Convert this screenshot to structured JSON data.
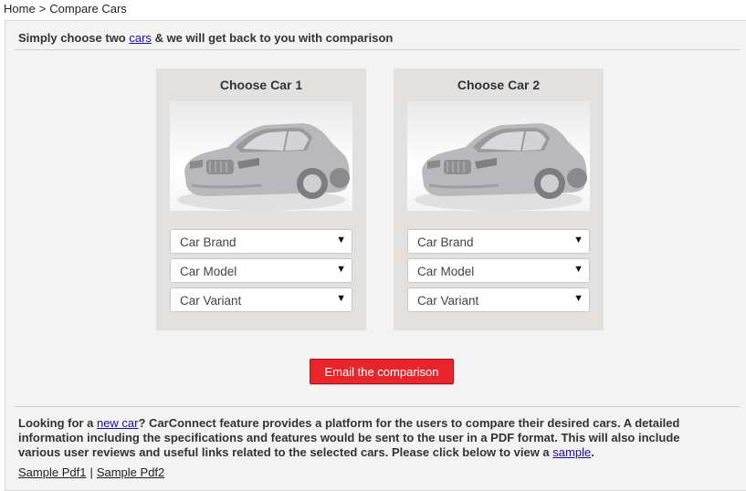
{
  "breadcrumb": {
    "home": "Home",
    "separator": ">",
    "current": "Compare Cars"
  },
  "intro": {
    "prefix": "Simply choose two",
    "link": "cars",
    "suffix": "& we will get back to you with comparison"
  },
  "cars": [
    {
      "title": "Choose Car 1",
      "brand_placeholder": "Car Brand",
      "model_placeholder": "Car Model",
      "variant_placeholder": "Car Variant"
    },
    {
      "title": "Choose Car 2",
      "brand_placeholder": "Car Brand",
      "model_placeholder": "Car Model",
      "variant_placeholder": "Car Variant"
    }
  ],
  "dropdown_arrow": "▼",
  "email_button": "Email the comparison",
  "description": {
    "prefix": "Looking for a",
    "link": "new car",
    "body": "? CarConnect feature provides a platform for the users to compare their desired cars. A detailed information including the specifications and features would be sent to the user in a PDF format. This will also include various user reviews and useful links related to the selected cars. Please click below to view a",
    "sample_link": "sample",
    "end": "."
  },
  "samples": {
    "pdf1": "Sample Pdf1",
    "separator": "|",
    "pdf2": "Sample Pdf2"
  },
  "colors": {
    "button": "#e8252b",
    "panel": "#f3f3f3",
    "car_box": "#e2e1df",
    "link": "#1a0dab"
  }
}
